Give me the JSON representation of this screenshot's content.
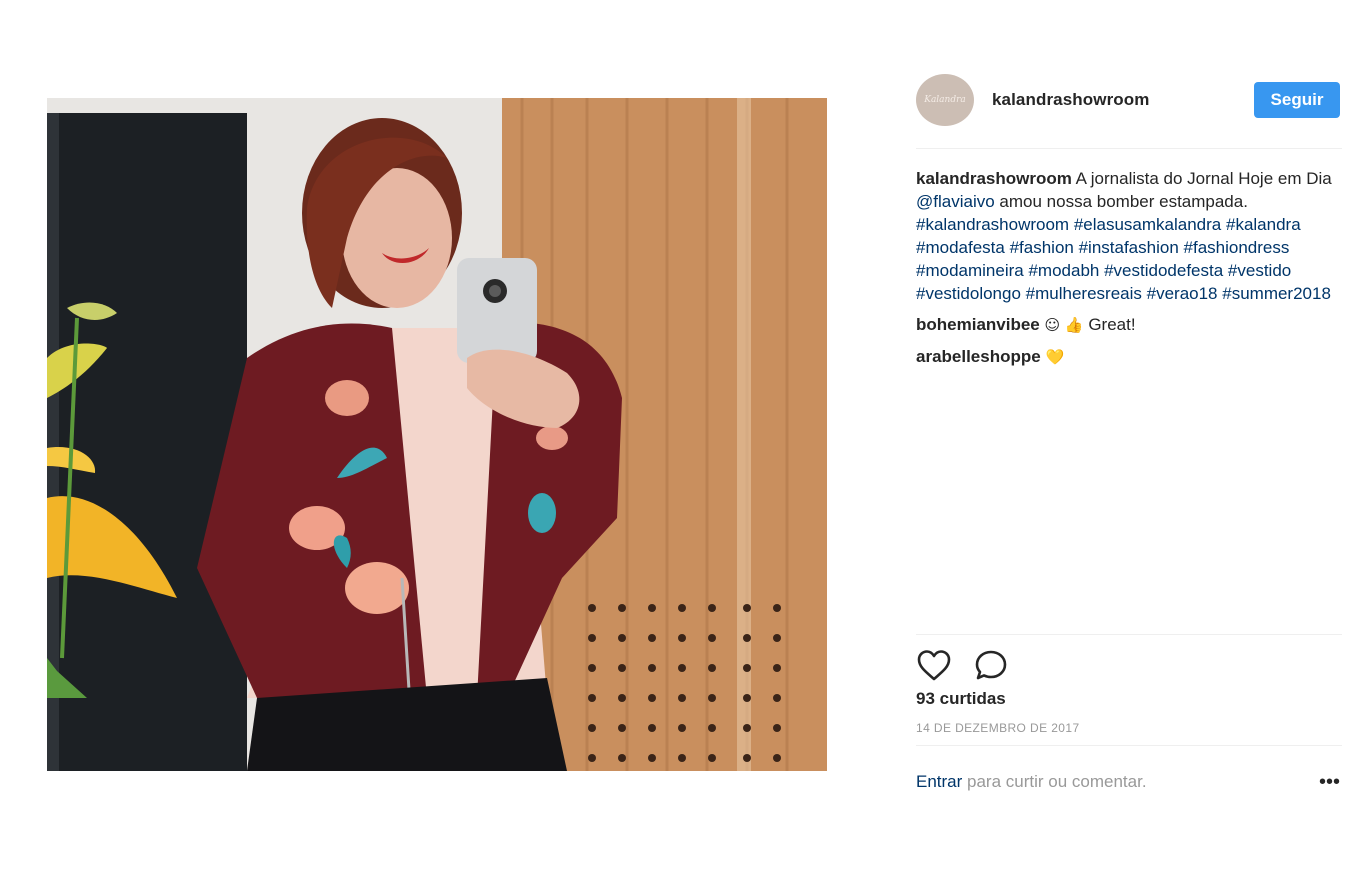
{
  "post": {
    "image_alt": "Mirror selfie of a woman in a floral bomber jacket",
    "author": "kalandrashowroom",
    "avatar_icon": "brand-logo-avatar",
    "avatar_logo_text": "Kalandra",
    "follow_label": "Seguir",
    "caption": {
      "author": "kalandrashowroom",
      "text_before_mention": " A jornalista do Jornal Hoje em Dia ",
      "mention": "@flaviaivo",
      "text_after_mention": " amou nossa bomber estampada.",
      "hashtags": [
        "#kalandrashowroom",
        "#elasusamkalandra",
        "#kalandra",
        "#modafesta",
        "#fashion",
        "#instafashion",
        "#fashiondress",
        "#modamineira",
        "#modabh",
        "#vestidodefesta",
        "#vestido",
        "#vestidolongo",
        "#mulheresreais",
        "#verao18",
        "#summer2018"
      ]
    },
    "comments": [
      {
        "author": "bohemianvibee",
        "emoji": "☺ 👍",
        "text": " Great!"
      },
      {
        "author": "arabelleshoppe",
        "emoji": "💛",
        "text": ""
      }
    ],
    "actions": {
      "like_icon": "heart-icon",
      "comment_icon": "comment-bubble-icon"
    },
    "likes": "93 curtidas",
    "date": "14 DE DEZEMBRO DE 2017",
    "login_link": "Entrar",
    "login_text": " para curtir ou comentar.",
    "more_icon": "more-options-icon",
    "colors": {
      "accent": "#3897f0",
      "link": "#003569",
      "muted": "#999999"
    }
  }
}
